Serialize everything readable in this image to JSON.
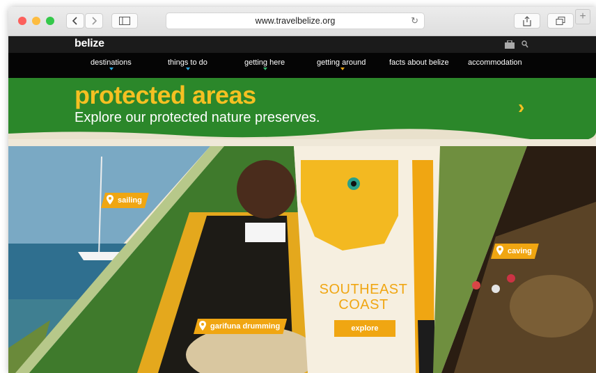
{
  "browser": {
    "url": "www.travelbelize.org",
    "colors": {
      "close": "#fc605c",
      "minimize": "#fdbc40",
      "zoom": "#34c84a"
    },
    "icons": [
      "back-icon",
      "forward-icon",
      "sidebar-icon",
      "reload-icon",
      "share-icon",
      "tabs-icon",
      "new-tab-icon"
    ]
  },
  "site": {
    "logo": "belize",
    "nav": [
      {
        "label": "destinations",
        "caret_color": "#2aa7e0"
      },
      {
        "label": "things to do",
        "caret_color": "#2aa7e0"
      },
      {
        "label": "getting here",
        "caret_color": "#35b46b"
      },
      {
        "label": "getting around",
        "caret_color": "#f0a612"
      },
      {
        "label": "facts about belize"
      },
      {
        "label": "accommodation"
      }
    ],
    "banner": {
      "title": "protected areas",
      "subtitle": "Explore our protected nature preserves."
    },
    "tiles": {
      "sailing": "sailing",
      "garifuna": "garifuna drumming",
      "region_title_line1": "SOUTHEAST",
      "region_title_line2": "COAST",
      "explore": "explore",
      "caving": "caving"
    },
    "colors": {
      "accent": "#f0a612",
      "banner": "#2f8f2d",
      "title": "#f5c022"
    }
  }
}
